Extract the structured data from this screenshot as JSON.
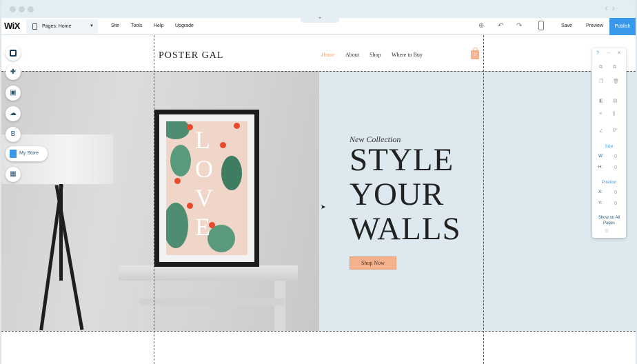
{
  "toolbar": {
    "logo": "WiX",
    "pages_label": "Pages: Home",
    "menu": [
      "Site",
      "Tools",
      "Help",
      "Upgrade"
    ],
    "save_label": "Save",
    "preview_label": "Preview",
    "publish_label": "Publish"
  },
  "site": {
    "brand": "POSTER GAL",
    "nav": [
      "Home",
      "About",
      "Shop",
      "Where to Buy"
    ],
    "cart_count": "0",
    "tagline": "New Collection",
    "headline": [
      "STYLE",
      "YOUR",
      "WALLS"
    ],
    "cta": "Shop Now",
    "poster_letters": [
      "L",
      "O",
      "V",
      "E"
    ]
  },
  "left_panel": {
    "my_store_label": "My Store"
  },
  "inspector": {
    "help": "?",
    "size_label": "Size",
    "w_label": "W:",
    "h_label": "H:",
    "position_label": "Position",
    "x_label": "X:",
    "y_label": "Y:",
    "show_all_pages": "Show on All Pages",
    "rotation": "0°",
    "w_value": "0",
    "h_value": "0",
    "x_value": "0",
    "y_value": "0"
  },
  "colors": {
    "accent": "#3899ec",
    "hero_bg": "#dde9ee",
    "cta_bg": "#f4b28c",
    "nav_active": "#f0a982"
  }
}
